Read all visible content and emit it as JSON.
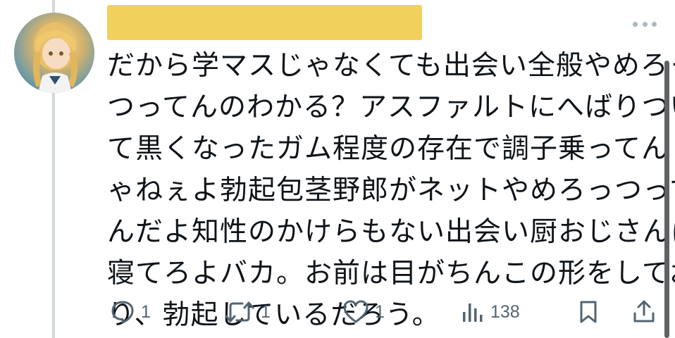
{
  "tweet": {
    "text_lines": [
      "だから学マスじゃなくても出会い全般やめろっ",
      "つってんのわかる？アスファルトにへばりつい",
      "て黒くなったガム程度の存在で調子乗ってんじ",
      "ゃねぇよ勃起包茎野郎がネットやめろっつって",
      "んだよ知性のかけらもない出会い厨おじさんは",
      "寝てろよバカ。お前は目がちんこの形をしてお",
      "り、勃起しているだろう。"
    ]
  },
  "actions": {
    "reply_count": "1",
    "retweet_count": "1",
    "like_count": "1",
    "views_count": "138"
  },
  "icons": {
    "reply": "reply-icon",
    "retweet": "retweet-icon",
    "like": "heart-icon",
    "views": "views-icon",
    "bookmark": "bookmark-icon",
    "share": "share-icon",
    "more": "more-icon"
  },
  "colors": {
    "text": "#0f1419",
    "secondary": "#536471",
    "thread_line": "#cfd9de",
    "name_redaction": "#f2d05c"
  }
}
